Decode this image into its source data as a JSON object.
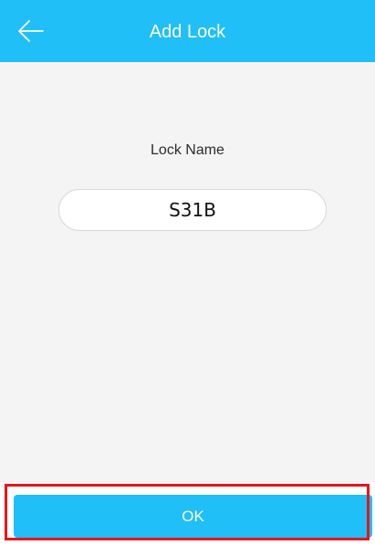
{
  "header": {
    "title": "Add Lock",
    "back_icon": "arrow-left-icon",
    "background_color": "#20bff7"
  },
  "form": {
    "lock_name_label": "Lock Name",
    "lock_name_value": "S31B"
  },
  "footer": {
    "ok_label": "OK",
    "button_color": "#20bff7",
    "highlight_color": "#e8151b"
  }
}
